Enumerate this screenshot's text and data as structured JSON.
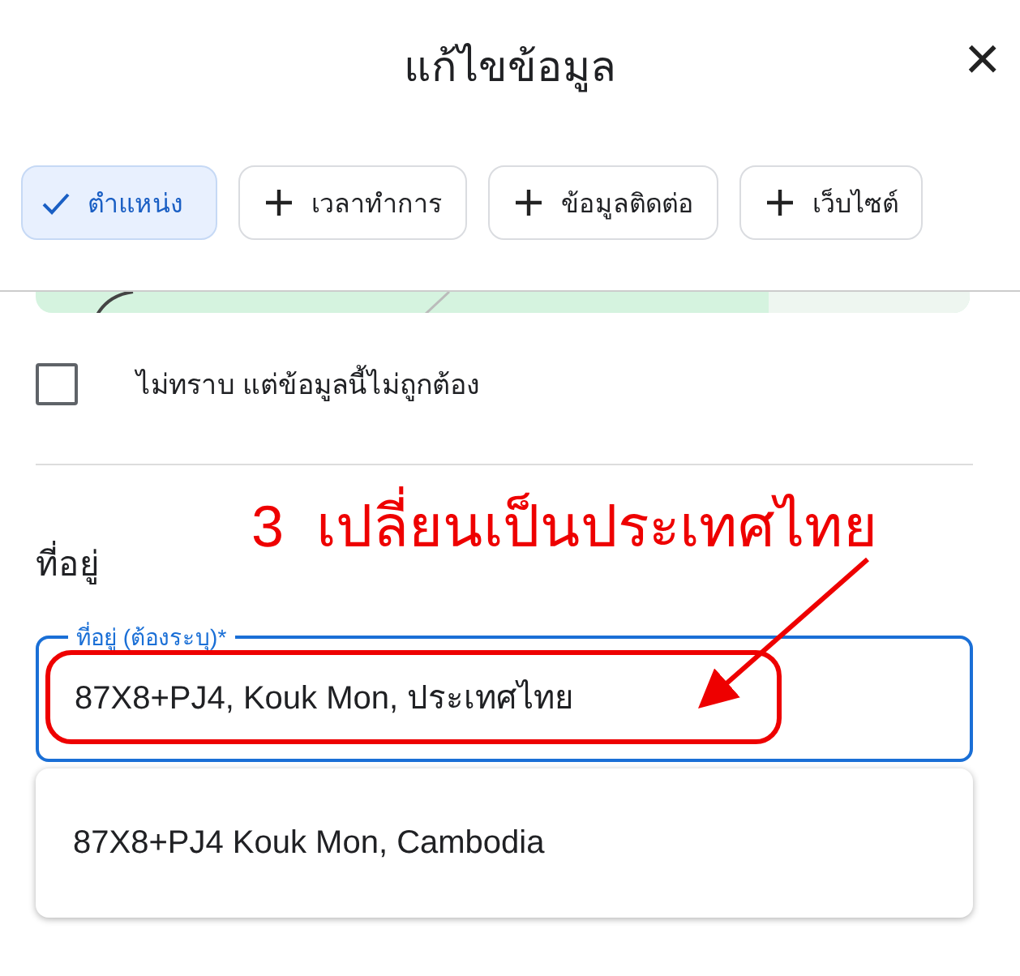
{
  "dialog": {
    "title": "แก้ไขข้อมูล",
    "close": "×"
  },
  "chips": [
    {
      "label": "ตำแหน่ง",
      "selected": true
    },
    {
      "label": "เวลาทำการ",
      "selected": false
    },
    {
      "label": "ข้อมูลติดต่อ",
      "selected": false
    },
    {
      "label": "เว็บไซต์",
      "selected": false
    }
  ],
  "checkbox": {
    "label": "ไม่ทราบ แต่ข้อมูลนี้ไม่ถูกต้อง",
    "checked": false
  },
  "address": {
    "heading": "ที่อยู่",
    "field_label": "ที่อยู่ (ต้องระบุ)*",
    "value": "87X8+PJ4, Kouk Mon, ประเทศไทย"
  },
  "suggestions": [
    "87X8+PJ4 Kouk Mon, Cambodia"
  ],
  "annotation": {
    "text": "3  เปลี่ยนเป็นประเทศไทย"
  }
}
